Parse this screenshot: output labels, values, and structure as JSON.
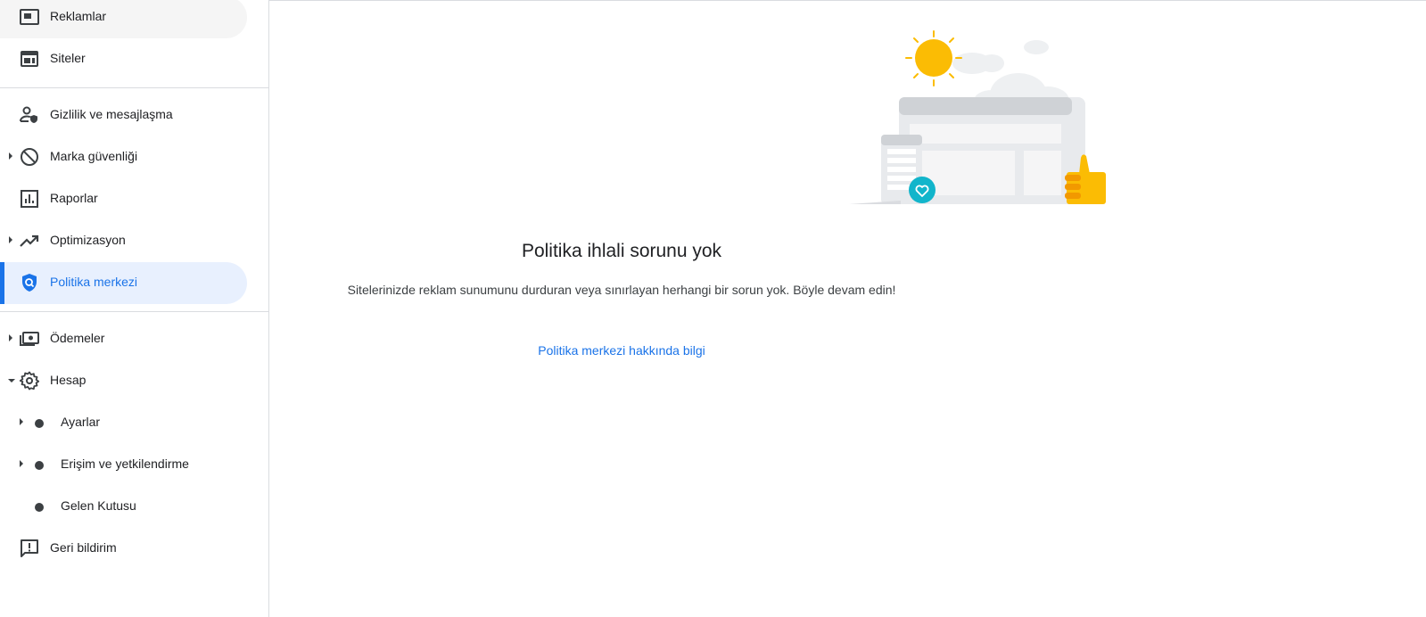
{
  "sidebar": {
    "items": [
      {
        "label": "Reklamlar",
        "icon": "ads-icon"
      },
      {
        "label": "Siteler",
        "icon": "sites-icon"
      },
      {
        "label": "Gizlilik ve mesajlaşma",
        "icon": "privacy-messaging-icon"
      },
      {
        "label": "Marka güvenliği",
        "icon": "block-icon"
      },
      {
        "label": "Raporlar",
        "icon": "bar-chart-icon"
      },
      {
        "label": "Optimizasyon",
        "icon": "trending-up-icon"
      },
      {
        "label": "Politika merkezi",
        "icon": "policy-shield-icon"
      },
      {
        "label": "Ödemeler",
        "icon": "payments-icon"
      },
      {
        "label": "Hesap",
        "icon": "gear-icon"
      },
      {
        "label": "Ayarlar",
        "icon": "bullet-icon"
      },
      {
        "label": "Erişim ve yetkilendirme",
        "icon": "bullet-icon"
      },
      {
        "label": "Gelen Kutusu",
        "icon": "bullet-icon"
      },
      {
        "label": "Geri bildirim",
        "icon": "feedback-icon"
      }
    ],
    "active_item": "Politika merkezi"
  },
  "main": {
    "title": "Politika ihlali sorunu yok",
    "subtitle": "Sitelerinizde reklam sunumunu durduran veya sınırlayan herhangi bir sorun yok. Böyle devam edin!",
    "learn_more_link": "Politika merkezi hakkında bilgi"
  },
  "colors": {
    "accent": "#1a73e8",
    "active_bg": "#e8f0fe",
    "sun": "#fbbc04",
    "teal": "#12b5cb"
  }
}
